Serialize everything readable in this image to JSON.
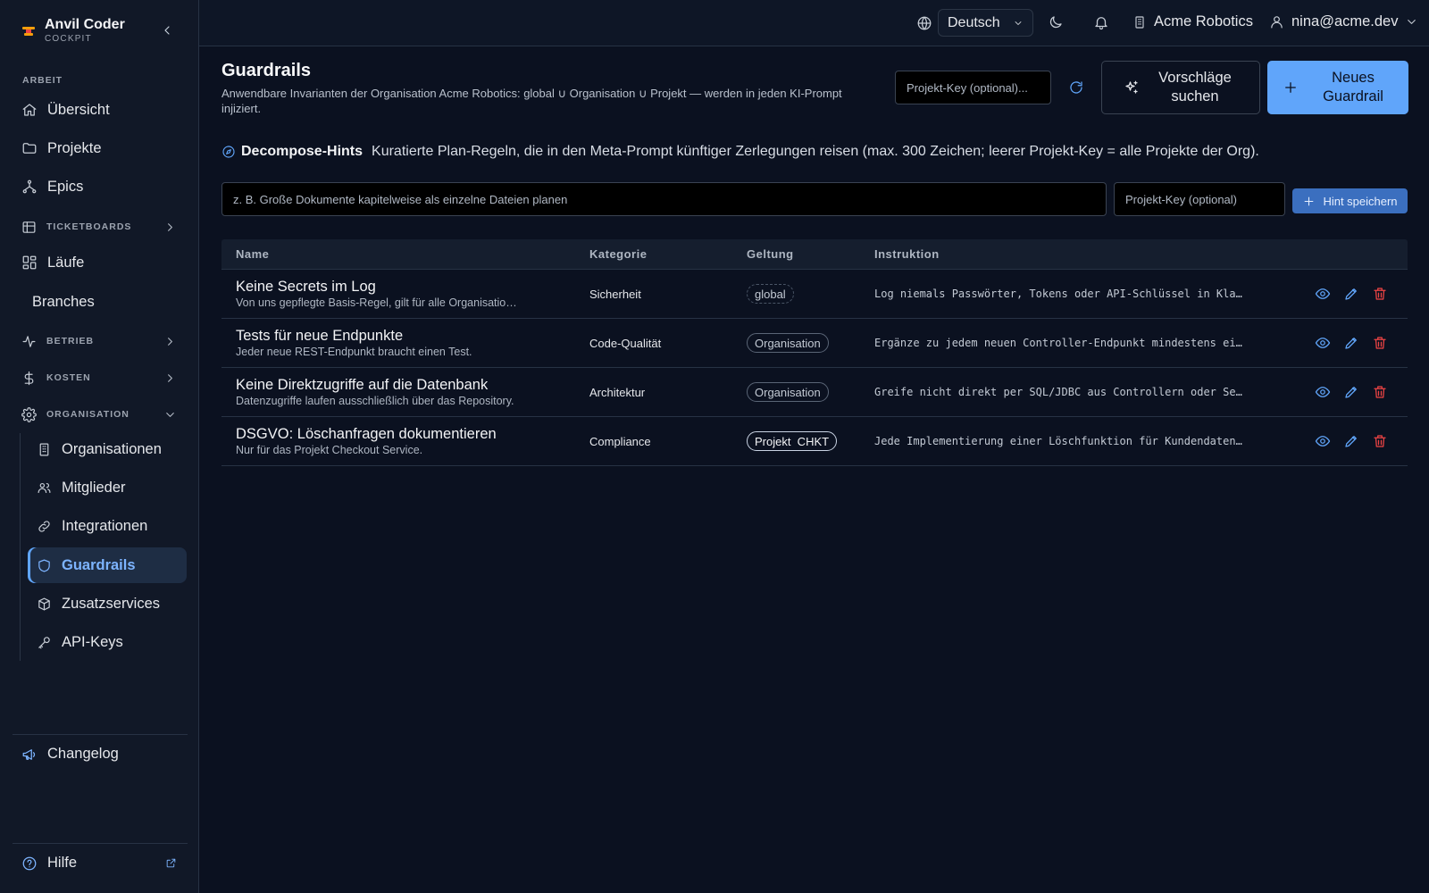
{
  "brand": {
    "title": "Anvil Coder",
    "subtitle": "COCKPIT"
  },
  "sidebar": {
    "section_work": "ARBEIT",
    "items": [
      {
        "label": "Übersicht",
        "icon": "home-icon"
      },
      {
        "label": "Projekte",
        "icon": "folder-icon"
      },
      {
        "label": "Epics",
        "icon": "tree-icon"
      },
      {
        "label": "TICKETBOARDS",
        "icon": "table-icon"
      },
      {
        "label": "Läufe",
        "icon": "dashboard-icon"
      },
      {
        "label": "Branches"
      },
      {
        "label": "BETRIEB",
        "icon": "activity-icon"
      },
      {
        "label": "KOSTEN",
        "icon": "dollar-icon"
      },
      {
        "label": "ORGANISATION",
        "icon": "gear-icon"
      }
    ],
    "org_items": [
      {
        "label": "Organisationen",
        "icon": "building-icon"
      },
      {
        "label": "Mitglieder",
        "icon": "users-icon"
      },
      {
        "label": "Integrationen",
        "icon": "link-icon"
      },
      {
        "label": "Guardrails",
        "icon": "shield-icon",
        "active": true
      },
      {
        "label": "Zusatzservices",
        "icon": "box-icon"
      },
      {
        "label": "API-Keys",
        "icon": "key-icon"
      }
    ],
    "changelog": "Changelog",
    "help": "Hilfe"
  },
  "topbar": {
    "language": "Deutsch",
    "organization": "Acme Robotics",
    "user": "nina@acme.dev"
  },
  "page": {
    "title": "Guardrails",
    "description": "Anwendbare Invarianten der Organisation Acme Robotics: global ∪ Organisation ∪ Projekt — werden in jeden KI-Prompt injiziert.",
    "project_key_placeholder": "Projekt-Key (optional)...",
    "suggest_label": "Vorschläge suchen",
    "new_label": "Neues Guardrail"
  },
  "hints": {
    "title": "Decompose-Hints",
    "description": "Kuratierte Plan-Regeln, die in den Meta-Prompt künftiger Zerlegungen reisen (max. 300 Zeichen; leerer Projekt-Key = alle Projekte der Org).",
    "hint_placeholder": "z. B. Große Dokumente kapitelweise als einzelne Dateien planen",
    "key_placeholder": "Projekt-Key (optional)",
    "save_label": "Hint speichern"
  },
  "table": {
    "headers": {
      "name": "Name",
      "category": "Kategorie",
      "scope": "Geltung",
      "instruction": "Instruktion"
    },
    "rows": [
      {
        "title": "Keine Secrets im Log",
        "desc": "Von uns gepflegte Basis-Regel, gilt für alle Organisationen.",
        "category": "Sicherheit",
        "scope": "global",
        "instruction": "Log niemals Passwörter, Tokens oder API-Schlüssel in Klartext."
      },
      {
        "title": "Tests für neue Endpunkte",
        "desc": "Jeder neue REST-Endpunkt braucht einen Test.",
        "category": "Code-Qualität",
        "scope": "Organisation",
        "instruction": "Ergänze zu jedem neuen Controller-Endpunkt mindestens einen Test."
      },
      {
        "title": "Keine Direktzugriffe auf die Datenbank",
        "desc": "Datenzugriffe laufen ausschließlich über das Repository.",
        "category": "Architektur",
        "scope": "Organisation",
        "instruction": "Greife nicht direkt per SQL/JDBC aus Controllern oder Services zu."
      },
      {
        "title": "DSGVO: Löschanfragen dokumentieren",
        "desc": "Nur für das Projekt Checkout Service.",
        "category": "Compliance",
        "scope": "Projekt  CHKT",
        "instruction": "Jede Implementierung einer Löschfunktion für Kundendaten dokumentieren."
      }
    ]
  },
  "colors": {
    "accent": "#60a5fa",
    "danger": "#ef4444",
    "background": "#0b1120",
    "sidebar": "#111827"
  }
}
